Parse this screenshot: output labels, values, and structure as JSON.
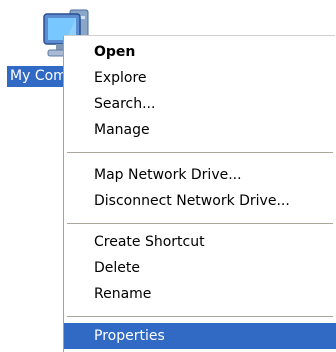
{
  "desktop": {
    "icon": {
      "name": "computer-icon",
      "label": "My Computer"
    }
  },
  "menu": {
    "items": [
      {
        "label": "Open",
        "bold": true
      },
      {
        "label": "Explore"
      },
      {
        "label": "Search..."
      },
      {
        "label": "Manage"
      },
      {
        "label": "Map Network Drive..."
      },
      {
        "label": "Disconnect Network Drive..."
      },
      {
        "label": "Create Shortcut"
      },
      {
        "label": "Delete"
      },
      {
        "label": "Rename"
      },
      {
        "label": "Properties",
        "selected": true
      }
    ]
  },
  "colors": {
    "selection": "#316ac5",
    "separator": "#aca899"
  }
}
